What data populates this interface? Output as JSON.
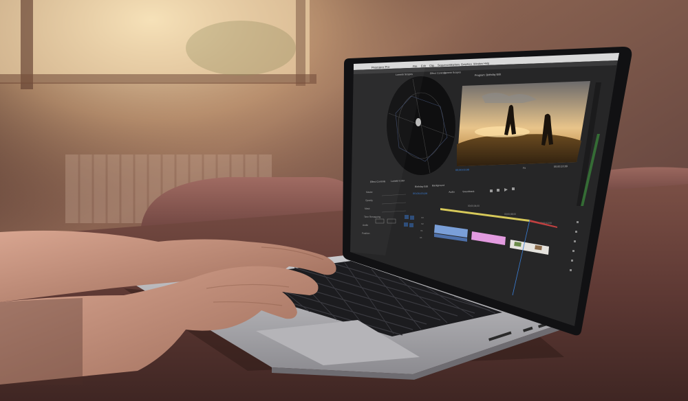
{
  "screen": {
    "menu": {
      "app_name": "Premiere Pro",
      "items": [
        "File",
        "Edit",
        "Clip",
        "Sequence",
        "Markers",
        "Graphics",
        "Window",
        "Help"
      ]
    },
    "scopes_panel": {
      "tabs": [
        "Lumetri Scopes",
        "Effect Controls",
        "Lumetri Scopes"
      ]
    },
    "program_monitor": {
      "tab": "Program: Birthday Edit",
      "timecode_left": "00;00;03;09",
      "timecode_right": "00;00;10;09",
      "fit": "Fit"
    },
    "effect_controls": {
      "tabs": [
        "Effect Controls",
        "Lumetri Color"
      ],
      "rows": [
        "Master",
        "Opacity",
        "Mask",
        "Time Remapping",
        "Audio",
        "Position"
      ]
    },
    "timeline": {
      "tabs": [
        "Birthday Edit",
        "Background",
        "Audio",
        "Soundtrack"
      ],
      "timecode": "00;00;03;09",
      "ruler": [
        "00;00;04;00",
        "00;00;08;00",
        "00;00;12;00"
      ],
      "tracks": [
        "V3",
        "V2",
        "V1",
        "A1"
      ]
    },
    "colors": {
      "clip_blue": "#7a9fd8",
      "clip_pink": "#e39be0",
      "clip_yellow": "#d7c95a",
      "ui_bg": "#232323",
      "playhead": "#3a7fd8"
    }
  }
}
